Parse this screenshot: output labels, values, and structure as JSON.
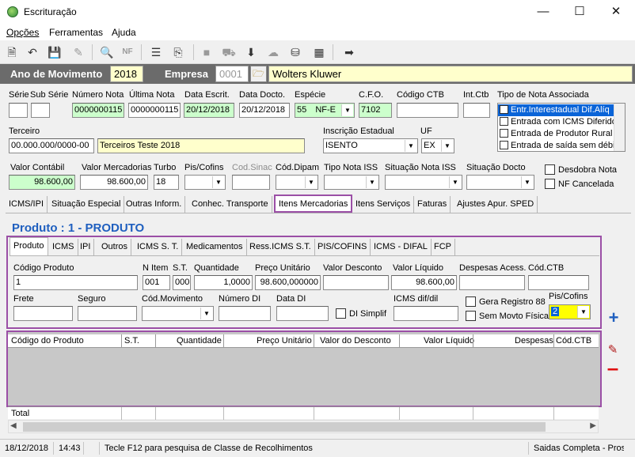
{
  "window": {
    "title": "Escrituração"
  },
  "menu": [
    "Opções",
    "Ferramentas",
    "Ajuda"
  ],
  "header": {
    "ano_label": "Ano de Movimento",
    "ano_value": "2018",
    "empresa_label": "Empresa",
    "empresa_code": "0001",
    "empresa_name": "Wolters Kluwer"
  },
  "nota": {
    "serie_label": "Série",
    "subserie_label": "Sub Série",
    "numero_label": "Número Nota",
    "numero_value": "0000000115",
    "ultima_label": "Última Nota",
    "ultima_value": "0000000115",
    "escrit_label": "Data Escrit.",
    "escrit_value": "20/12/2018",
    "docto_label": "Data Docto.",
    "docto_value": "20/12/2018",
    "especie_label": "Espécie",
    "especie_code": "55",
    "especie_value": "NF-E",
    "cfo_label": "C.F.O.",
    "cfo_value": "7102",
    "codctb_label": "Código CTB",
    "intctb_label": "Int.Ctb",
    "tipo_label": "Tipo de Nota Associada",
    "tipo_items": [
      "Entr.Interestadual Dif.Alíq",
      "Entrada com ICMS Diferido",
      "Entrada de Produtor Rural",
      "Entrada de saída sem débi"
    ],
    "terceiro_label": "Terceiro",
    "terceiro_code": "00.000.000/0000-00",
    "terceiro_name": "Terceiros Teste 2018",
    "ie_label": "Inscrição Estadual",
    "ie_value": "ISENTO",
    "uf_label": "UF",
    "uf_value": "EX",
    "vcontabil_label": "Valor Contábil",
    "vcontabil_value": "98.600,00",
    "vmerc_label": "Valor Mercadorias",
    "vmerc_value": "98.600,00",
    "turbo_label": "Turbo",
    "turbo_value": "18",
    "piscofins_label": "Pis/Cofins",
    "codsinac_label": "Cod.Sinac",
    "coddipam_label": "Cód.Dipam",
    "tiponotaiss_label": "Tipo Nota ISS",
    "sitnotaiss_label": "Situação Nota ISS",
    "sitdocto_label": "Situação Docto",
    "desdobra_label": "Desdobra Nota",
    "cancelada_label": "NF Cancelada"
  },
  "main_tabs": [
    "ICMS/IPI",
    "Situação Especial",
    "Outras Inform.",
    "Conhec. Transporte",
    "Itens Mercadorias",
    "Itens Serviços",
    "Faturas",
    "Ajustes Apur. SPED"
  ],
  "produto_title": "Produto : 1 - PRODUTO",
  "sub_tabs": [
    "Produto",
    "ICMS",
    "IPI",
    "Outros",
    "ICMS S. T.",
    "Medicamentos",
    "Ress.ICMS S.T.",
    "PIS/COFINS",
    "ICMS - DIFAL",
    "FCP"
  ],
  "produto": {
    "codigo_label": "Código Produto",
    "codigo_value": "1",
    "nitem_label": "N Item",
    "nitem_value": "001",
    "st_label": "S.T.",
    "st_value": "000",
    "qtd_label": "Quantidade",
    "qtd_value": "1,0000",
    "preco_label": "Preço Unitário",
    "preco_value": "98.600,000000",
    "desconto_label": "Valor Desconto",
    "liquido_label": "Valor Líquido",
    "liquido_value": "98.600,00",
    "despesas_label": "Despesas Acess.",
    "codctb_label": "Cód.CTB",
    "frete_label": "Frete",
    "seguro_label": "Seguro",
    "codmov_label": "Cód.Movimento",
    "numdi_label": "Número DI",
    "datadi_label": "Data DI",
    "disimplif_label": "DI Simplif",
    "icmsdif_label": "ICMS dif/dil",
    "gera_label": "Gera Registro 88",
    "semmovto_label": "Sem Movto Física",
    "piscofins_label": "Pis/Cofins",
    "piscofins_value": "2"
  },
  "grid": {
    "columns": [
      "Código do Produto",
      "S.T.",
      "Quantidade",
      "Preço Unitário",
      "Valor do Desconto",
      "Valor Líquido",
      "Despesas",
      "Cód.CTB"
    ],
    "total_label": "Total"
  },
  "status": {
    "date": "18/12/2018",
    "time": "14:43",
    "hint": "Tecle F12 para pesquisa de Classe de Recolhimentos",
    "mode": "Saidas Completa - Pros"
  },
  "colors": {
    "accent": "#1f5fbf",
    "highlight_border": "#9b4fa6",
    "yellow_field": "#ffffcc",
    "green_field": "#ccffcc"
  }
}
